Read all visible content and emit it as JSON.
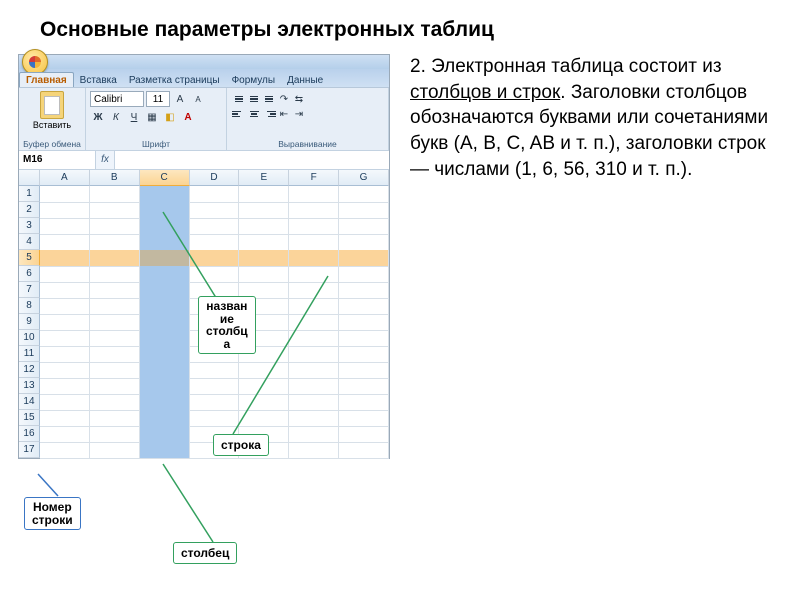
{
  "title": "Основные параметры электронных таблиц",
  "description": {
    "lead": "2. Электронная таблица состоит из ",
    "underlined": "столбцов и строк",
    "rest": ". Заголовки столбцов обозначаются буквами или сочетаниями букв (A, B, C,  AB и т. п.), заголовки строк — числами (1, 6, 56, 310 и т. п.)."
  },
  "excel": {
    "tabs": [
      "Главная",
      "Вставка",
      "Разметка страницы",
      "Формулы",
      "Данные"
    ],
    "active_tab_index": 0,
    "groups": {
      "clipboard": "Буфер обмена",
      "font": "Шрифт",
      "align": "Выравнивание"
    },
    "paste_label": "Вставить",
    "font_name": "Calibri",
    "font_size": "11",
    "name_box": "M16",
    "columns": [
      "A",
      "B",
      "C",
      "D",
      "E",
      "F",
      "G"
    ],
    "rows": [
      "1",
      "2",
      "3",
      "4",
      "5",
      "6",
      "7",
      "8",
      "9",
      "10",
      "11",
      "12",
      "13",
      "14",
      "15",
      "16",
      "17"
    ],
    "selected_col_index": 2,
    "selected_row_index": 4
  },
  "callouts": {
    "col_name": "назван\nие\nстолбц\nа",
    "row_label": "строка",
    "row_num": "Номер\nстроки",
    "column": "столбец"
  }
}
